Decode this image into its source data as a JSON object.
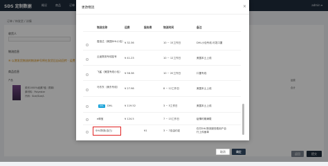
{
  "app": {
    "logo": "SDS 定制数据",
    "nav": [
      "概况",
      "商品",
      "订单"
    ],
    "user": "admin ▾"
  },
  "page": {
    "breadcrumb": "订单 / 待发货 / 详情",
    "section_receiver": "收货人",
    "section_logistics": "物流信息",
    "notice": "④ 以港发货物流的物流单号将在发货后自动回传 · 运费",
    "section_products": "商品信息"
  },
  "product": {
    "name": "荧光1000%经典T恤（男款）",
    "sub": "原材料：Polyester",
    "size": "尺码：Size/Size/L",
    "label_price": "产品",
    "label_ship": "运费",
    "total_label": "合计"
  },
  "bottom_buttons": {
    "back": "返回",
    "submit": "提交"
  },
  "modal": {
    "title": "更改物流",
    "headers": {
      "name": "物流名称",
      "freight": "运费",
      "service_fee": "服务费",
      "time": "物流时间",
      "remark": "备注"
    },
    "rows": [
      {
        "name": "嘉信达（美国DHL小包）",
        "freight": "¥ 32.36",
        "service_fee": "",
        "time": "10 ~ 15工作日",
        "remark": "DHL小包专线-可发口罩",
        "badge": ""
      },
      {
        "name": "云途物流专线挂号",
        "freight": "¥ 41.23",
        "service_fee": "",
        "time": "10 ~ 12工作日",
        "remark": "美国本土上线",
        "badge": ""
      },
      {
        "name": "飞鲨（美国专线小包）",
        "freight": "¥ 58.38",
        "service_fee": "",
        "time": "10 ~ 20工作日",
        "remark": "口罩专线",
        "badge": ""
      },
      {
        "name": "马东东（美东专线）",
        "freight": "¥ 27.98",
        "service_fee": "",
        "time": "8 ~ 12工作日",
        "remark": "美国本土上线",
        "badge": ""
      },
      {
        "name": "DHL",
        "freight": "¥ 119.52",
        "service_fee": "",
        "time": "3 ~ 5工作日",
        "remark": "美国本土上线",
        "badge": "DHL"
      },
      {
        "name": "e邮宝",
        "freight": "¥ 124.5",
        "service_fee": "",
        "time": "7 ~ 15工作日",
        "remark": "疫情时期满载",
        "badge": ""
      },
      {
        "name": "SHL物流(自己)",
        "freight": "",
        "service_fee": "¥1",
        "time": "3 ~ 7自由约定",
        "remark": "仅付SHL物流服务费用户自行上传面单",
        "badge": ""
      }
    ],
    "cancel": "取消",
    "confirm": "确定"
  },
  "colors": {
    "highlight": "#e02020",
    "dark": "#1f2d3d",
    "dhl_badge": "#1aa3d9"
  }
}
